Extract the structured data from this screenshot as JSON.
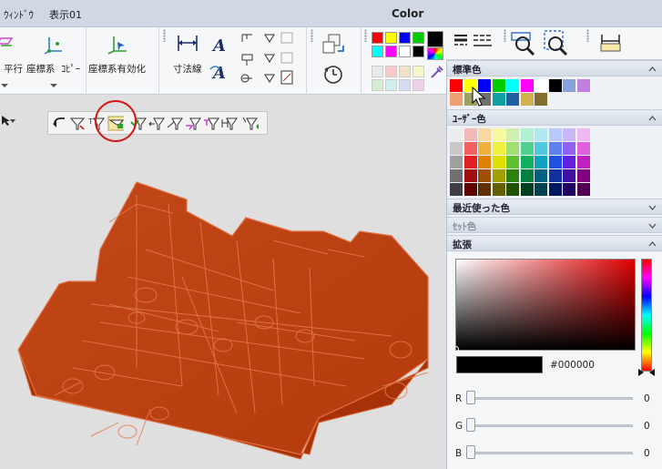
{
  "titlebar": {
    "menu_window": "ｳｨﾝﾄﾞｳ",
    "menu_display": "表示01",
    "title": "Color"
  },
  "ribbon": {
    "label_parallel": "平行",
    "label_coord": "座標系",
    "label_copy": "ｺﾋﾟｰ",
    "label_coord_enable": "座標系有効化",
    "label_dimension": "寸法線"
  },
  "panel": {
    "standard_title": "標準色",
    "user_title": "ﾕｰｻﾞｰ色",
    "recent_title": "最近使った色",
    "set_title": "ｾｯﾄ色",
    "extend_title": "拡張",
    "hex_value": "#000000",
    "sliders": [
      {
        "label": "R",
        "value": "0"
      },
      {
        "label": "G",
        "value": "0"
      },
      {
        "label": "B",
        "value": "0"
      }
    ],
    "standard_colors": [
      "#ff0000",
      "#ffff00",
      "#0000ff",
      "#00cc00",
      "#00ffff",
      "#ff00ff",
      "#ffffff",
      "#000000",
      "#8aa0d8",
      "#c080e0",
      "#f0a070",
      "#a0a060",
      "#707070",
      "#10a0a0",
      "#2060a0",
      "#d0b050",
      "#807030"
    ],
    "user_colors": [
      [
        "#ececec",
        "#f4b8b8",
        "#f8d8a0",
        "#f8f8a0",
        "#d0f0b0",
        "#b0f0d0",
        "#b0e8f0",
        "#b8c8f8",
        "#c8b8f8",
        "#f0b8f0"
      ],
      [
        "#c8c8c8",
        "#f06060",
        "#f0b040",
        "#f0f040",
        "#a0e070",
        "#50d090",
        "#50c8e0",
        "#6080f0",
        "#9060f0",
        "#e060e0"
      ],
      [
        "#a0a0a0",
        "#e02020",
        "#e08000",
        "#e0e000",
        "#60c030",
        "#10b060",
        "#10a0c0",
        "#2050e0",
        "#6020e0",
        "#c020c0"
      ],
      [
        "#707070",
        "#a01010",
        "#a05000",
        "#a0a000",
        "#308010",
        "#008040",
        "#006080",
        "#1030a0",
        "#4010a0",
        "#800080"
      ],
      [
        "#404040",
        "#600000",
        "#603000",
        "#606000",
        "#205000",
        "#004020",
        "#004050",
        "#001860",
        "#200060",
        "#500050"
      ]
    ]
  }
}
